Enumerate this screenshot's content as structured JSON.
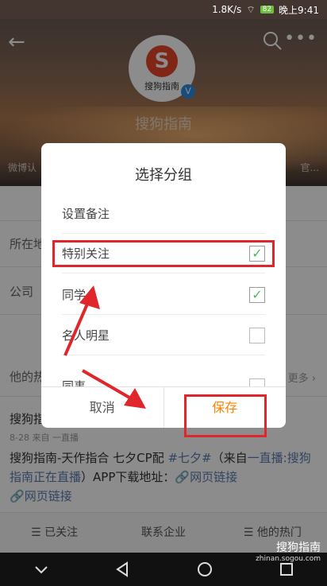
{
  "status": {
    "speed": "1.8K/s",
    "battery": "82",
    "time": "晚上9:41"
  },
  "header": {
    "logo_text": "搜狗指南",
    "profile_name": "搜狗指南",
    "left_info": "微博认",
    "right_info": "官..."
  },
  "background": {
    "row1_label": "所在地",
    "row2_label": "公司",
    "feed_section_label": "他的热",
    "feed_more": "更多 ›",
    "feed_author": "搜狗指",
    "feed_meta": "8-28 来自 一直播",
    "feed_text_plain_1": "搜狗指南-天作指合 七夕CP配 ",
    "feed_hashtag": "#七夕#",
    "feed_text_plain_2": "（来自",
    "feed_live_link": "一直播:搜狗指南正在直播",
    "feed_text_plain_3": "）APP下载地址：",
    "feed_link_1": "网页链接",
    "feed_link_2": "网页链接"
  },
  "bottom_tabs": [
    {
      "label": "☰ 已关注"
    },
    {
      "label": "联系企业"
    },
    {
      "label": "☰ 他的热门"
    }
  ],
  "dialog": {
    "title": "选择分组",
    "remark_label": "设置备注",
    "options": [
      {
        "label": "特别关注",
        "checked": true
      },
      {
        "label": "同学",
        "checked": true
      },
      {
        "label": "名人明星",
        "checked": false
      },
      {
        "label": "同事",
        "checked": false
      }
    ],
    "cancel_label": "取消",
    "save_label": "保存"
  },
  "watermark": {
    "main": "搜狗指南",
    "sub": "zhinan.sogou.com"
  },
  "colors": {
    "accent": "#ff8200",
    "check": "#4bb95a",
    "annotation": "#e0262b"
  }
}
